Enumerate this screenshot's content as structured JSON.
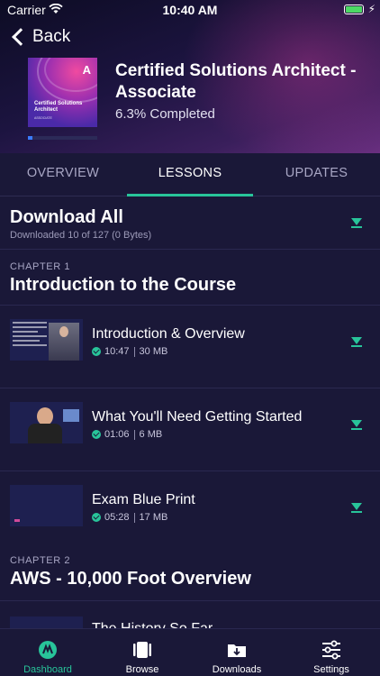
{
  "status_bar": {
    "carrier": "Carrier",
    "time": "10:40 AM"
  },
  "nav": {
    "back_label": "Back"
  },
  "course": {
    "title": "Certified Solutions Architect - Associate",
    "progress_text": "6.3% Completed",
    "progress_fraction": 0.063,
    "thumb_logo": "A",
    "thumb_title": "Certified Solutions Architect",
    "thumb_subtitle": "ASSOCIATE"
  },
  "tabs": [
    {
      "label": "OVERVIEW",
      "active": false
    },
    {
      "label": "LESSONS",
      "active": true
    },
    {
      "label": "UPDATES",
      "active": false
    }
  ],
  "download_all": {
    "title": "Download All",
    "subtitle": "Downloaded 10 of 127 (0 Bytes)"
  },
  "chapters": [
    {
      "label": "CHAPTER 1",
      "title": "Introduction to the Course",
      "lessons": [
        {
          "title": "Introduction & Overview",
          "duration": "10:47",
          "size": "30 MB"
        },
        {
          "title": "What You'll Need Getting Started",
          "duration": "01:06",
          "size": "6 MB"
        },
        {
          "title": "Exam Blue Print",
          "duration": "05:28",
          "size": "17 MB"
        }
      ]
    },
    {
      "label": "CHAPTER 2",
      "title": "AWS - 10,000 Foot Overview",
      "lessons": [
        {
          "title": "The History So Far"
        }
      ]
    }
  ],
  "bottom_nav": [
    {
      "label": "Dashboard",
      "icon": "dashboard-icon",
      "active": true
    },
    {
      "label": "Browse",
      "icon": "browse-icon",
      "active": false
    },
    {
      "label": "Downloads",
      "icon": "downloads-icon",
      "active": false
    },
    {
      "label": "Settings",
      "icon": "settings-icon",
      "active": false
    }
  ],
  "colors": {
    "accent": "#28c49a",
    "background": "#1a1838",
    "progress": "#3a7bff"
  }
}
